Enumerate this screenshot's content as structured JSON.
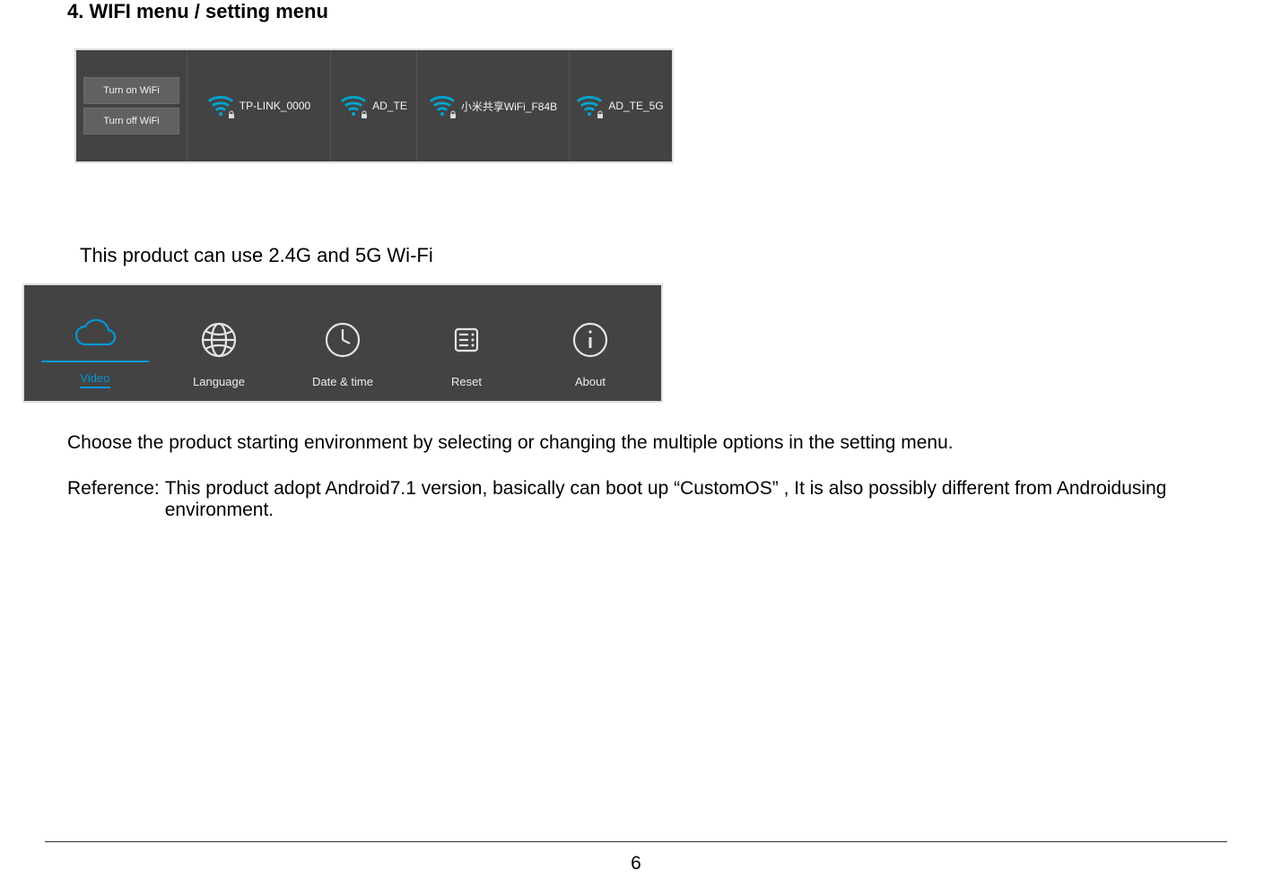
{
  "section_title": "4. WIFI menu / setting menu",
  "wifi_menu": {
    "toggle_labels": [
      "Turn on WiFi",
      "Turn off WiFi"
    ],
    "networks": [
      {
        "ssid": "TP-LINK_0000",
        "signal_color": "#00a3cc",
        "locked": true
      },
      {
        "ssid": "AD_TE",
        "signal_color": "#00a3cc",
        "locked": true
      },
      {
        "ssid": "小米共享WiFi_F84B",
        "signal_color": "#00a3cc",
        "locked": true
      },
      {
        "ssid": "AD_TE_5G",
        "signal_color": "#00a3cc",
        "locked": true
      }
    ]
  },
  "wifi_note": "This product can use 2.4G and 5G Wi-Fi",
  "settings_menu": {
    "items": [
      {
        "label": "Video",
        "icon": "cloud",
        "selected": true
      },
      {
        "label": "Language",
        "icon": "globe",
        "selected": false
      },
      {
        "label": "Date & time",
        "icon": "clock",
        "selected": false
      },
      {
        "label": "Reset",
        "icon": "reset",
        "selected": false
      },
      {
        "label": "About",
        "icon": "info",
        "selected": false
      }
    ]
  },
  "body_text": "Choose the product starting environment by selecting or changing the multiple options in the setting menu.",
  "reference_label": "Reference:",
  "reference_text": "This product adopt Android7.1 version, basically can boot up “CustomOS” , It is also possibly different from Androidusing environment.",
  "page_number": "6"
}
